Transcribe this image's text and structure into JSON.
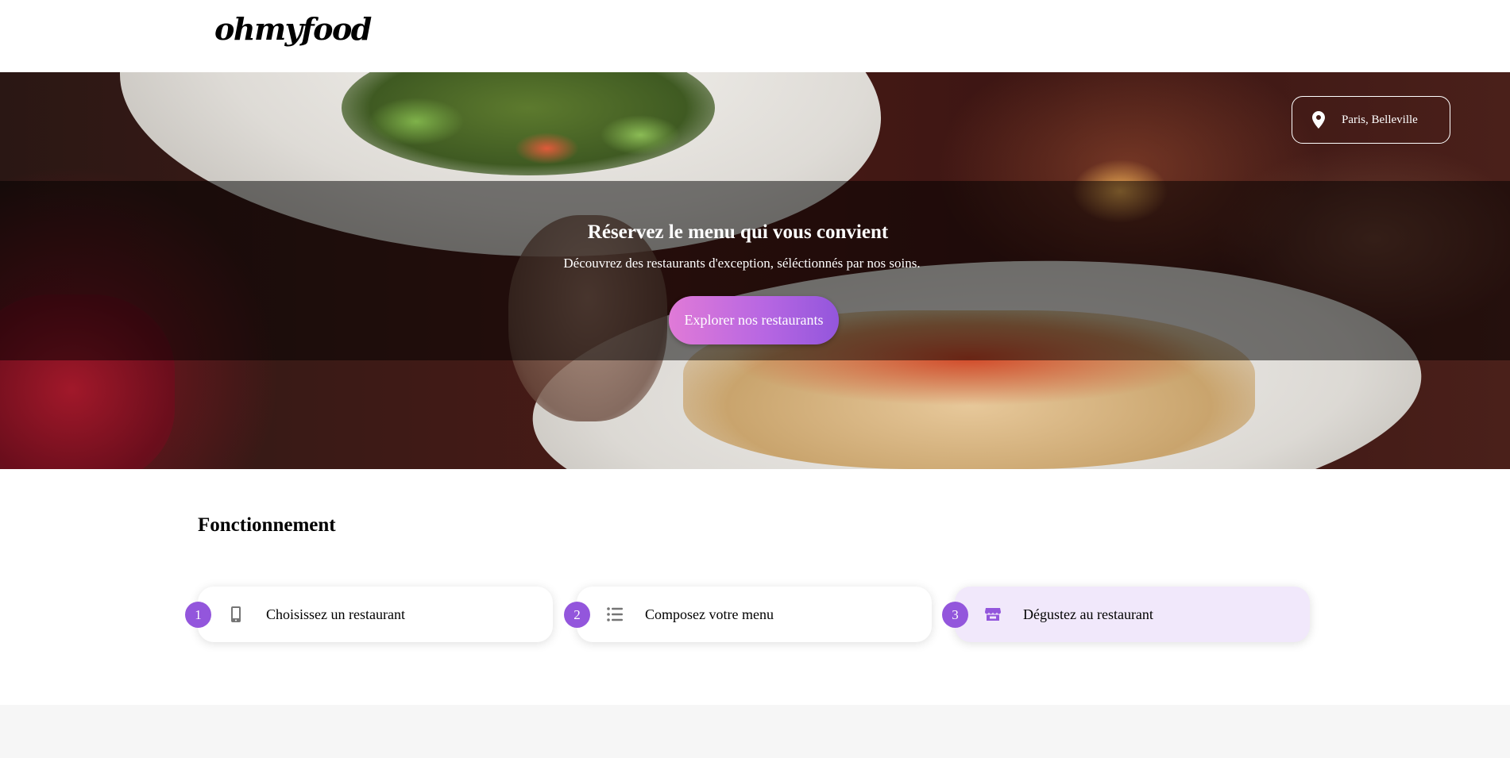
{
  "header": {
    "logo": "ohmyfood"
  },
  "hero": {
    "location": "Paris, Belleville",
    "title": "Réservez le menu qui vous convient",
    "subtitle": "Découvrez des restaurants d'exception, séléctionnés par nos soins.",
    "cta_label": "Explorer nos restaurants"
  },
  "how_it_works": {
    "title": "Fonctionnement",
    "steps": [
      {
        "number": "1",
        "label": "Choisissez un restaurant",
        "icon": "mobile-phone-icon"
      },
      {
        "number": "2",
        "label": "Composez votre menu",
        "icon": "list-icon"
      },
      {
        "number": "3",
        "label": "Dégustez au restaurant",
        "icon": "store-icon"
      }
    ]
  },
  "colors": {
    "accent": "#9356dc",
    "accent_pink": "#e07ad7",
    "active_step_bg": "#f1e8fb",
    "section_gray": "#f6f6f6"
  }
}
